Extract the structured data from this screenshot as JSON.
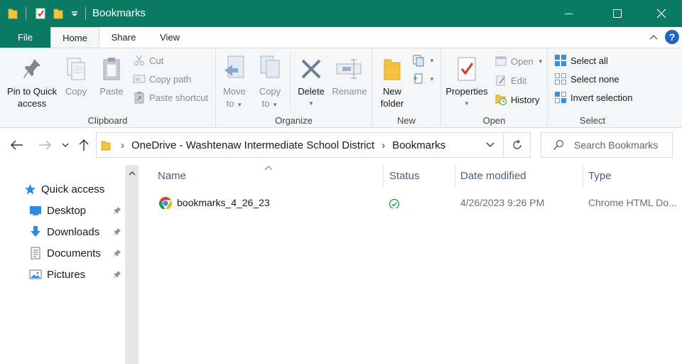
{
  "window": {
    "title": "Bookmarks",
    "accent": "#0b7a63"
  },
  "ribbon_tabs": [
    "File",
    "Home",
    "Share",
    "View"
  ],
  "ribbon": {
    "clipboard": {
      "label": "Clipboard",
      "pin_line1": "Pin to Quick",
      "pin_line2": "access",
      "copy": "Copy",
      "paste": "Paste",
      "cut": "Cut",
      "copy_path": "Copy path",
      "paste_shortcut": "Paste shortcut"
    },
    "organize": {
      "label": "Organize",
      "move_to_line1": "Move",
      "move_to_line2": "to",
      "copy_to_line1": "Copy",
      "copy_to_line2": "to",
      "delete": "Delete",
      "rename": "Rename"
    },
    "new": {
      "label": "New",
      "new_folder_line1": "New",
      "new_folder_line2": "folder"
    },
    "open": {
      "label": "Open",
      "properties": "Properties",
      "open": "Open",
      "edit": "Edit",
      "history": "History"
    },
    "select": {
      "label": "Select",
      "select_all": "Select all",
      "select_none": "Select none",
      "invert_selection": "Invert selection"
    }
  },
  "address": {
    "crumbs": [
      "OneDrive - Washtenaw Intermediate School District",
      "Bookmarks"
    ],
    "search_placeholder": "Search Bookmarks"
  },
  "nav_pane": {
    "quick_access": "Quick access",
    "items": [
      {
        "label": "Desktop",
        "icon": "desktop-icon",
        "pinned": true
      },
      {
        "label": "Downloads",
        "icon": "downloads-icon",
        "pinned": true
      },
      {
        "label": "Documents",
        "icon": "documents-icon",
        "pinned": true
      },
      {
        "label": "Pictures",
        "icon": "pictures-icon",
        "pinned": true
      }
    ]
  },
  "file_list": {
    "columns": [
      "Name",
      "Status",
      "Date modified",
      "Type"
    ],
    "rows": [
      {
        "name": "bookmarks_4_26_23",
        "icon": "chrome-icon",
        "status": "synced",
        "date_modified": "4/26/2023 9:26 PM",
        "type": "Chrome HTML Do..."
      }
    ]
  }
}
